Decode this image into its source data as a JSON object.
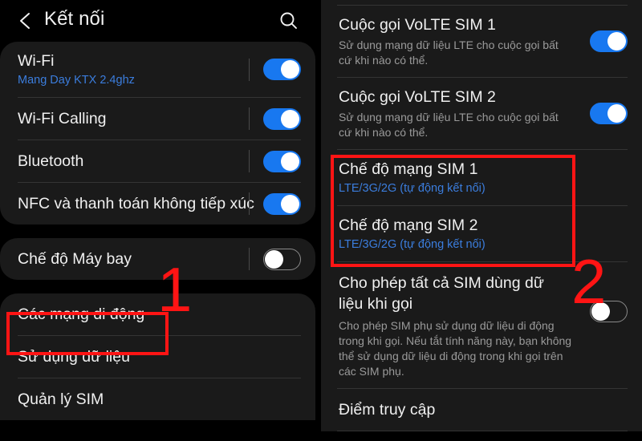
{
  "theme": {
    "page_bg": "#000000",
    "card_bg": "#1a1a1a",
    "accent_blue": "#1878f0",
    "link_blue": "#3b7ddd",
    "annotation_red": "#ff1414",
    "title_text": "#f0f0f0",
    "sub_text": "#9a9a9a"
  },
  "left_panel": {
    "header": {
      "back_icon": "chevron-left-icon",
      "title": "Kết nối",
      "search_icon": "search-icon"
    },
    "group1": [
      {
        "title": "Wi-Fi",
        "subtitle": "Mang Day KTX 2.4ghz",
        "subtitle_style": "blue",
        "toggle": "on"
      },
      {
        "title": "Wi-Fi Calling",
        "subtitle": "",
        "toggle": "on"
      },
      {
        "title": "Bluetooth",
        "subtitle": "",
        "toggle": "on"
      },
      {
        "title": "NFC và thanh toán không tiếp xúc",
        "subtitle": "",
        "toggle": "on"
      }
    ],
    "group2": [
      {
        "title": "Chế độ Máy bay",
        "subtitle": "",
        "toggle": "off"
      }
    ],
    "group3": [
      {
        "title": "Các mạng di động",
        "subtitle": "",
        "toggle": "none"
      },
      {
        "title": "Sử dụng dữ liệu",
        "subtitle": "",
        "toggle": "none"
      },
      {
        "title": "Quản lý SIM",
        "subtitle": "",
        "toggle": "none"
      }
    ]
  },
  "right_panel": {
    "rows": [
      {
        "title": "Cuộc gọi VoLTE SIM 1",
        "subtitle": "Sử dụng mạng dữ liệu LTE cho cuộc gọi bất cứ khi nào có thể.",
        "subtitle_style": "grey",
        "toggle": "on"
      },
      {
        "title": "Cuộc gọi VoLTE SIM 2",
        "subtitle": "Sử dụng mạng dữ liệu LTE cho cuộc gọi bất cứ khi nào có thể.",
        "subtitle_style": "grey",
        "toggle": "on"
      },
      {
        "title": "Chế độ mạng SIM 1",
        "subtitle": "LTE/3G/2G (tự động kết nối)",
        "subtitle_style": "blue",
        "toggle": "none"
      },
      {
        "title": "Chế độ mạng SIM 2",
        "subtitle": "LTE/3G/2G (tự động kết nối)",
        "subtitle_style": "blue",
        "toggle": "none"
      },
      {
        "title": "Cho phép tất cả SIM dùng dữ liệu khi gọi",
        "subtitle": "Cho phép SIM phụ sử dụng dữ liệu di động trong khi gọi. Nếu tắt tính năng này, bạn không thể sử dụng dữ liệu di động trong khi gọi trên các SIM phụ.",
        "subtitle_style": "grey",
        "toggle": "off"
      },
      {
        "title": "Điểm truy cập",
        "subtitle": "",
        "toggle": "none"
      }
    ]
  },
  "annotations": {
    "step1_number": "1",
    "step2_number": "2"
  }
}
